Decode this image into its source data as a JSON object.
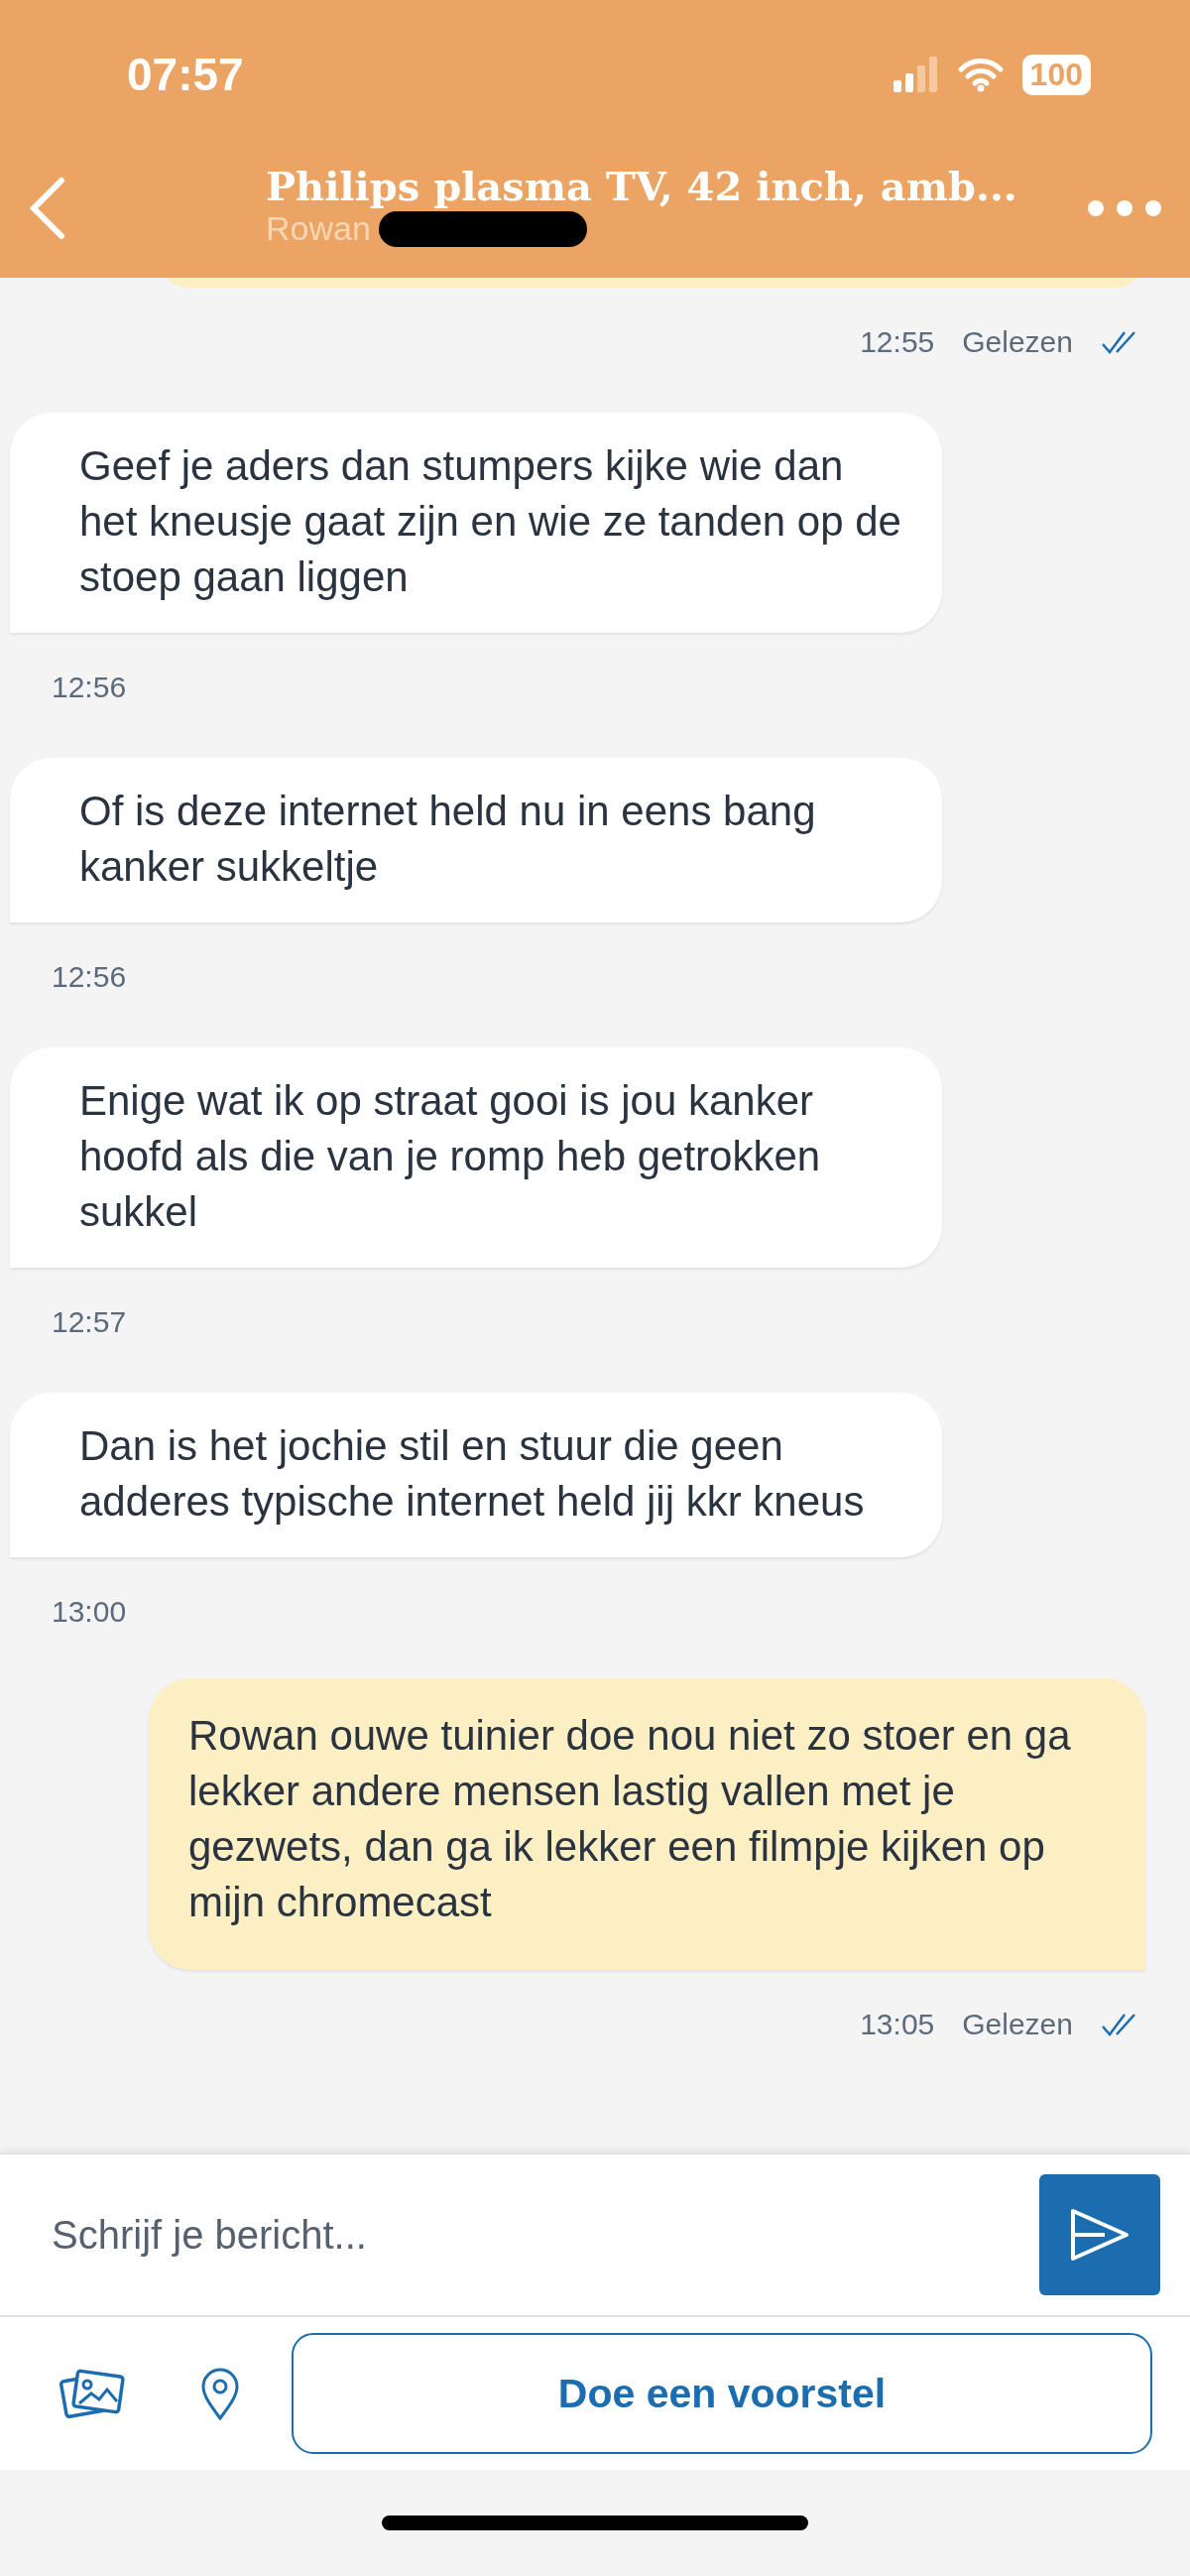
{
  "status_bar": {
    "time": "07:57",
    "battery": "100"
  },
  "header": {
    "title": "Philips plasma TV, 42 inch, amb...",
    "subtitle": "Rowan"
  },
  "messages": [
    {
      "kind": "sent_cut",
      "time": "12:55",
      "status": "Gelezen"
    },
    {
      "kind": "received",
      "text": "Geef je aders dan stumpers kijke wie dan het kneusje gaat zijn en wie ze tanden op de stoep gaan liggen",
      "time": "12:56"
    },
    {
      "kind": "received",
      "text": "Of is deze internet held nu in eens bang kanker sukkeltje",
      "time": "12:56"
    },
    {
      "kind": "received",
      "text": "Enige wat ik op straat gooi is jou kanker hoofd als die van je romp heb getrokken sukkel",
      "time": "12:57"
    },
    {
      "kind": "received",
      "text": "Dan is het jochie stil en stuur die geen adderes typische internet held jij kkr kneus",
      "time": "13:00"
    },
    {
      "kind": "sent",
      "text": "Rowan ouwe tuinier doe nou niet zo stoer en ga lekker andere mensen lastig vallen met je gezwets, dan ga ik lekker een filmpje kijken op mijn chromecast",
      "time": "13:05",
      "status": "Gelezen"
    }
  ],
  "composer": {
    "placeholder": "Schrijf je bericht...",
    "offer_button": "Doe een voorstel"
  }
}
